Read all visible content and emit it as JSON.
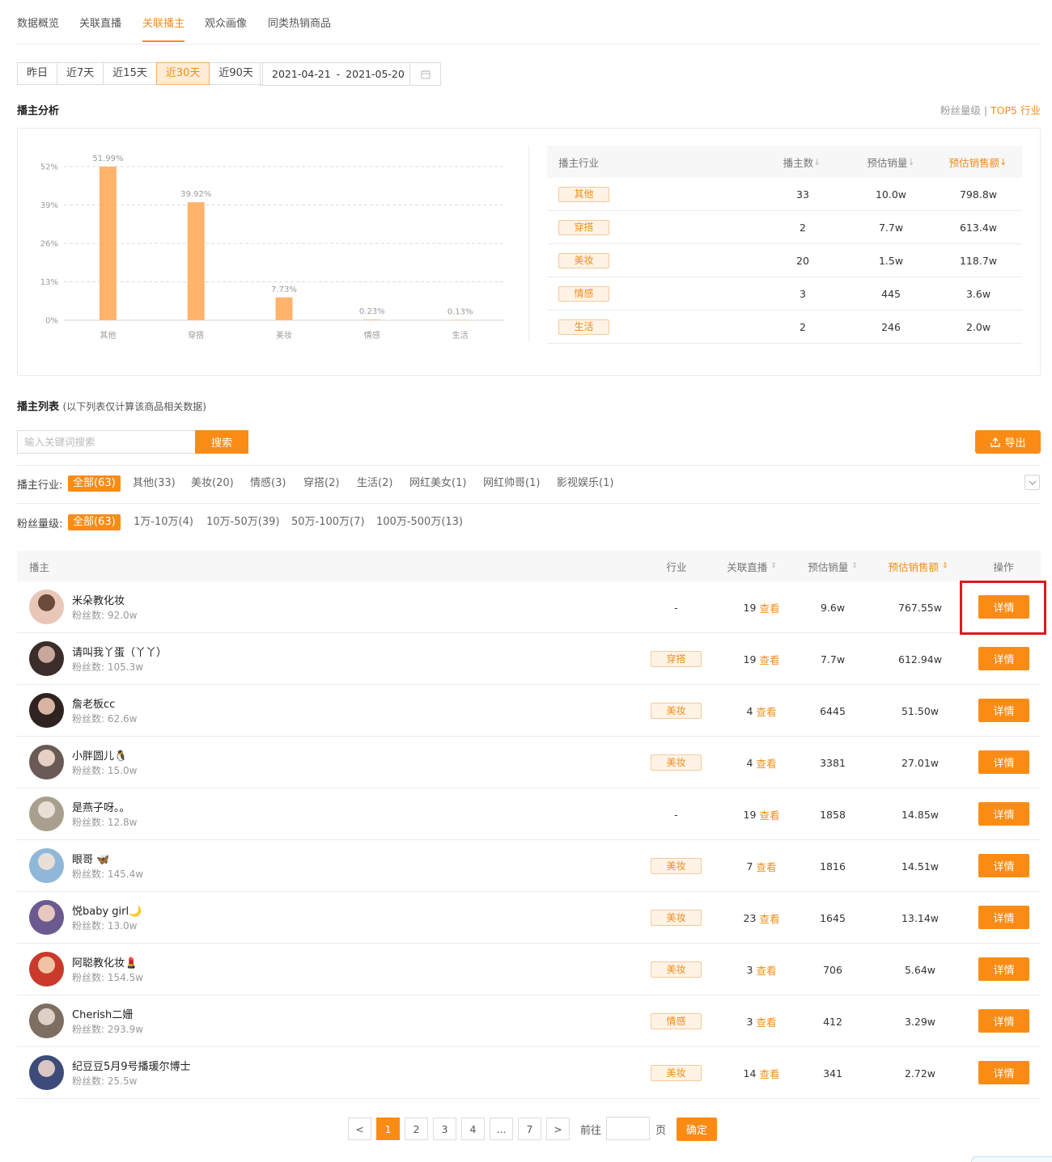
{
  "tabs": [
    "数据概览",
    "关联直播",
    "关联播主",
    "观众画像",
    "同类热销商品"
  ],
  "active_tab": 2,
  "date_buttons": [
    "昨日",
    "近7天",
    "近15天",
    "近30天",
    "近90天"
  ],
  "active_date": 3,
  "date_range": {
    "start": "2021-04-21",
    "sep": "-",
    "end": "2021-05-20"
  },
  "analysis": {
    "title": "播主分析",
    "toggle_fans": "粉丝量级",
    "toggle_sep": "|",
    "toggle_top5": "TOP5 行业"
  },
  "chart_data": {
    "type": "bar",
    "categories": [
      "其他",
      "穿搭",
      "美妆",
      "情感",
      "生活"
    ],
    "values": [
      51.99,
      39.92,
      7.73,
      0.23,
      0.13
    ],
    "value_labels": [
      "51.99%",
      "39.92%",
      "7.73%",
      "0.23%",
      "0.13%"
    ],
    "ylim": [
      0,
      52
    ],
    "yticks": [
      0,
      13,
      26,
      39,
      52
    ],
    "ytick_labels": [
      "0%",
      "13%",
      "26%",
      "39%",
      "52%"
    ],
    "grid": true,
    "color": "#ffb36b"
  },
  "industry_table": {
    "headers": [
      "播主行业",
      "播主数",
      "预估销量",
      "预估销售额"
    ],
    "rows": [
      {
        "tag": "其他",
        "count": "33",
        "sales": "10.0w",
        "amount": "798.8w"
      },
      {
        "tag": "穿搭",
        "count": "2",
        "sales": "7.7w",
        "amount": "613.4w"
      },
      {
        "tag": "美妆",
        "count": "20",
        "sales": "1.5w",
        "amount": "118.7w"
      },
      {
        "tag": "情感",
        "count": "3",
        "sales": "445",
        "amount": "3.6w"
      },
      {
        "tag": "生活",
        "count": "2",
        "sales": "246",
        "amount": "2.0w"
      }
    ]
  },
  "list": {
    "title": "播主列表",
    "subtitle": "(以下列表仅计算该商品相关数据)",
    "search_placeholder": "输入关键词搜索",
    "search_btn": "搜索",
    "export_btn": "导出"
  },
  "filters": {
    "industry_label": "播主行业:",
    "industry_options": [
      "全部(63)",
      "其他(33)",
      "美妆(20)",
      "情感(3)",
      "穿搭(2)",
      "生活(2)",
      "网红美女(1)",
      "网红帅哥(1)",
      "影视娱乐(1)"
    ],
    "fans_label": "粉丝量级:",
    "fans_options": [
      "全部(63)",
      "1万-10万(4)",
      "10万-50万(39)",
      "50万-100万(7)",
      "100万-500万(13)"
    ]
  },
  "table": {
    "headers": [
      "播主",
      "行业",
      "关联直播",
      "预估销量",
      "预估销售额",
      "操作"
    ],
    "fans_prefix": "粉丝数: ",
    "view_label": "查看",
    "detail_label": "详情",
    "rows": [
      {
        "name": "米朵教化妆",
        "fans": "92.0w",
        "industry": "-",
        "live": "19",
        "sales": "9.6w",
        "amount": "767.55w"
      },
      {
        "name": "请叫我丫蛋（丫丫）",
        "fans": "105.3w",
        "industry": "穿搭",
        "live": "19",
        "sales": "7.7w",
        "amount": "612.94w"
      },
      {
        "name": "詹老板cc",
        "fans": "62.6w",
        "industry": "美妆",
        "live": "4",
        "sales": "6445",
        "amount": "51.50w"
      },
      {
        "name": "小胖圆儿🐧",
        "fans": "15.0w",
        "industry": "美妆",
        "live": "4",
        "sales": "3381",
        "amount": "27.01w"
      },
      {
        "name": "是燕子呀。。",
        "fans": "12.8w",
        "industry": "-",
        "live": "19",
        "sales": "1858",
        "amount": "14.85w"
      },
      {
        "name": "眼哥 🦋",
        "fans": "145.4w",
        "industry": "美妆",
        "live": "7",
        "sales": "1816",
        "amount": "14.51w"
      },
      {
        "name": "悦baby girl🌙",
        "fans": "13.0w",
        "industry": "美妆",
        "live": "23",
        "sales": "1645",
        "amount": "13.14w"
      },
      {
        "name": "阿聪教化妆💄",
        "fans": "154.5w",
        "industry": "美妆",
        "live": "3",
        "sales": "706",
        "amount": "5.64w"
      },
      {
        "name": "Cherish二姗",
        "fans": "293.9w",
        "industry": "情感",
        "live": "3",
        "sales": "412",
        "amount": "3.29w"
      },
      {
        "name": "纪豆豆5月9号播瑗尔博士",
        "fans": "25.5w",
        "industry": "美妆",
        "live": "14",
        "sales": "341",
        "amount": "2.72w"
      }
    ]
  },
  "pagination": {
    "prev": "<",
    "next": ">",
    "pages": [
      "1",
      "2",
      "3",
      "4",
      "...",
      "7"
    ],
    "active": "1",
    "goto_label": "前往",
    "page_unit": "页",
    "confirm": "确定"
  },
  "colors": {
    "accent": "#fa8c16",
    "highlight_box": "#e0161f"
  }
}
